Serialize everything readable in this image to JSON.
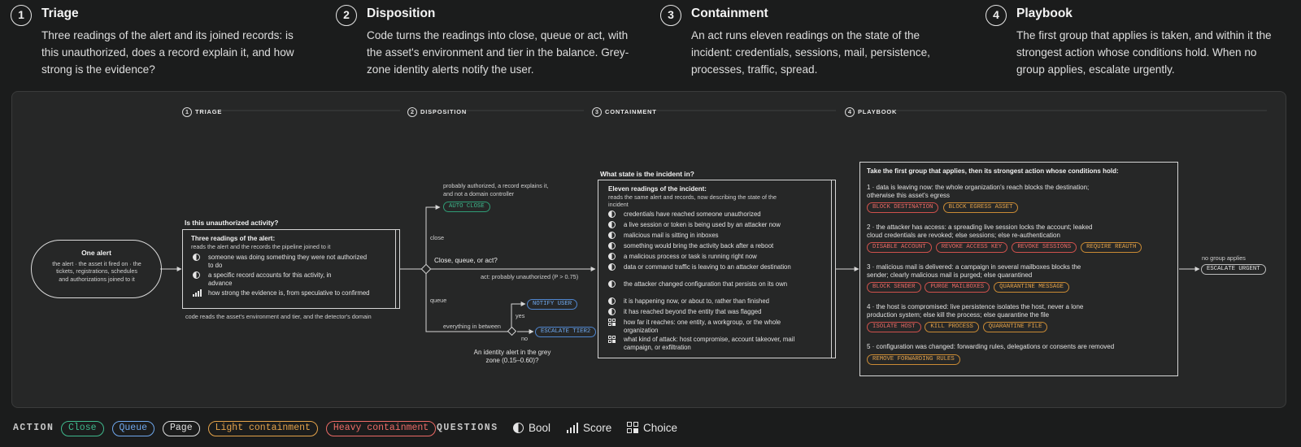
{
  "steps": [
    {
      "num": "1",
      "title": "Triage",
      "desc": "Three readings of the alert and its joined records: is this unauthorized, does a record explain it, and how strong is the evidence?"
    },
    {
      "num": "2",
      "title": "Disposition",
      "desc": "Code turns the readings into close, queue or act, with the asset's environment and tier in the balance. Grey-zone identity alerts notify the user."
    },
    {
      "num": "3",
      "title": "Containment",
      "desc": "An act runs eleven readings on the state of the incident: credentials, sessions, mail, persistence, processes, traffic, spread."
    },
    {
      "num": "4",
      "title": "Playbook",
      "desc": "The first group that applies is taken, and within it the strongest action whose conditions hold. When no group applies, escalate urgently."
    }
  ],
  "section_headers": [
    {
      "num": "1",
      "label": "TRIAGE"
    },
    {
      "num": "2",
      "label": "DISPOSITION"
    },
    {
      "num": "3",
      "label": "CONTAINMENT"
    },
    {
      "num": "4",
      "label": "PLAYBOOK"
    }
  ],
  "start": {
    "title": "One alert",
    "desc": "the alert · the asset it fired on · the tickets, registrations, schedules and authorizations joined to it"
  },
  "triage": {
    "question": "Is this unauthorized activity?",
    "box_title": "Three readings of the alert:",
    "box_sub": "reads the alert and the records the pipeline joined to it",
    "readings": [
      {
        "icon": "bool",
        "text": "someone was doing something they were not authorized to do"
      },
      {
        "icon": "bool",
        "text": "a specific record accounts for this activity, in advance"
      },
      {
        "icon": "score",
        "text": "how strong the evidence is, from speculative to confirmed"
      }
    ],
    "footnote": "code reads the asset's environment and tier, and the detector's domain"
  },
  "disposition": {
    "close_note": "probably authorized, a record explains it, and not a domain controller",
    "auto_close": "AUTO CLOSE",
    "close_label": "close",
    "question": "Close, queue, or act?",
    "act_label": "act: probably unauthorized (P > 0.75)",
    "queue_label": "queue",
    "between_label": "everything in between",
    "yes_label": "yes",
    "no_label": "no",
    "notify_user": "NOTIFY USER",
    "escalate_tier2": "ESCALATE TIER2",
    "grey_zone": "An identity alert in the grey zone (0.15–0.60)?"
  },
  "containment": {
    "question": "What state is the incident in?",
    "box_title": "Eleven readings of the incident:",
    "box_sub": "reads the same alert and records, now describing the state of the incident",
    "readings": [
      {
        "icon": "bool",
        "text": "credentials have reached someone unauthorized"
      },
      {
        "icon": "bool",
        "text": "a live session or token is being used by an attacker now"
      },
      {
        "icon": "bool",
        "text": "malicious mail is sitting in inboxes"
      },
      {
        "icon": "bool",
        "text": "something would bring the activity back after a reboot"
      },
      {
        "icon": "bool",
        "text": "a malicious process or task is running right now"
      },
      {
        "icon": "bool",
        "text": "data or command traffic is leaving to an attacker destination"
      },
      {
        "icon": "bool",
        "text": "the attacker changed configuration that persists on its own"
      },
      {
        "icon": "bool",
        "text": "it is happening now, or about to, rather than finished"
      },
      {
        "icon": "bool",
        "text": "it has reached beyond the entity that was flagged"
      },
      {
        "icon": "choice",
        "text": "how far it reaches: one entity, a workgroup, or the whole organization"
      },
      {
        "icon": "choice",
        "text": "what kind of attack: host compromise, account takeover, mail campaign, or exfiltration"
      }
    ]
  },
  "playbook": {
    "title": "Take the first group that applies, then its strongest action whose conditions hold:",
    "groups": [
      {
        "text": "1 · data is leaving now: the whole organization's reach blocks the destination; otherwise this asset's egress",
        "actions": [
          {
            "label": "BLOCK DESTINATION",
            "kind": "heavy"
          },
          {
            "label": "BLOCK EGRESS ASSET",
            "kind": "light"
          }
        ]
      },
      {
        "text": "2 · the attacker has access: a spreading live session locks the account; leaked cloud credentials are revoked; else sessions; else re-authentication",
        "actions": [
          {
            "label": "DISABLE ACCOUNT",
            "kind": "heavy"
          },
          {
            "label": "REVOKE ACCESS KEY",
            "kind": "heavy"
          },
          {
            "label": "REVOKE SESSIONS",
            "kind": "heavy"
          },
          {
            "label": "REQUIRE REAUTH",
            "kind": "light"
          }
        ]
      },
      {
        "text": "3 · malicious mail is delivered: a campaign in several mailboxes blocks the sender; clearly malicious mail is purged; else quarantined",
        "actions": [
          {
            "label": "BLOCK SENDER",
            "kind": "heavy"
          },
          {
            "label": "PURGE MAILBOXES",
            "kind": "heavy"
          },
          {
            "label": "QUARANTINE MESSAGE",
            "kind": "light"
          }
        ]
      },
      {
        "text": "4 · the host is compromised: live persistence isolates the host, never a lone production system; else kill the process; else quarantine the file",
        "actions": [
          {
            "label": "ISOLATE HOST",
            "kind": "heavy"
          },
          {
            "label": "KILL PROCESS",
            "kind": "light"
          },
          {
            "label": "QUARANTINE FILE",
            "kind": "light"
          }
        ]
      },
      {
        "text": "5 · configuration was changed: forwarding rules, delegations or consents are removed",
        "actions": [
          {
            "label": "REMOVE FORWARDING RULES",
            "kind": "light"
          }
        ]
      }
    ],
    "no_group_label": "no group applies",
    "escalate_urgent": "ESCALATE URGENT"
  },
  "legend": {
    "action_heading": "ACTION",
    "actions": [
      {
        "label": "Close",
        "kind": "close"
      },
      {
        "label": "Queue",
        "kind": "queue"
      },
      {
        "label": "Page",
        "kind": "page"
      },
      {
        "label": "Light containment",
        "kind": "light"
      },
      {
        "label": "Heavy containment",
        "kind": "heavy"
      }
    ],
    "questions_heading": "QUESTIONS",
    "questions": [
      {
        "label": "Bool",
        "icon": "bool"
      },
      {
        "label": "Score",
        "icon": "score"
      },
      {
        "label": "Choice",
        "icon": "choice"
      }
    ]
  },
  "colors": {
    "close": "#3fb98d",
    "queue": "#6fa8ee",
    "page": "#e0e0e0",
    "light": "#e3a24a",
    "heavy": "#eb6b66",
    "background": "#1b1c1c",
    "panel": "#262727"
  }
}
